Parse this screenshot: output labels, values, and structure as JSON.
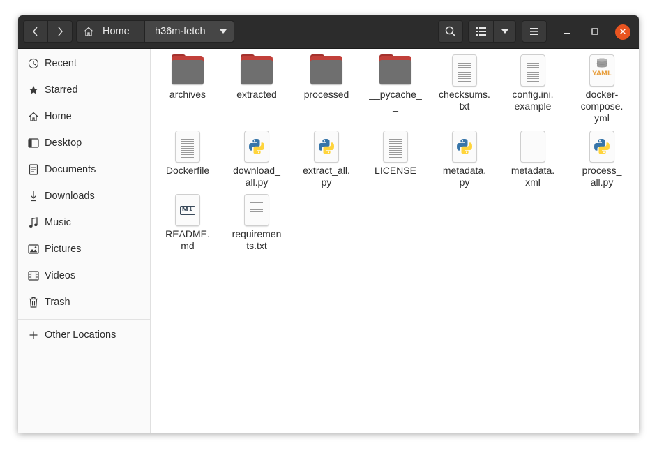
{
  "header": {
    "path_home": "Home",
    "path_current": "h36m-fetch"
  },
  "sidebar": {
    "items": [
      {
        "label": "Recent",
        "icon": "clock-icon"
      },
      {
        "label": "Starred",
        "icon": "star-icon"
      },
      {
        "label": "Home",
        "icon": "home-icon"
      },
      {
        "label": "Desktop",
        "icon": "desktop-icon"
      },
      {
        "label": "Documents",
        "icon": "document-icon"
      },
      {
        "label": "Downloads",
        "icon": "download-icon"
      },
      {
        "label": "Music",
        "icon": "music-note-icon"
      },
      {
        "label": "Pictures",
        "icon": "picture-icon"
      },
      {
        "label": "Videos",
        "icon": "film-icon"
      },
      {
        "label": "Trash",
        "icon": "trash-icon"
      }
    ],
    "other": {
      "label": "Other Locations",
      "icon": "plus-icon"
    }
  },
  "files": [
    {
      "name": "archives",
      "kind": "folder"
    },
    {
      "name": "extracted",
      "kind": "folder"
    },
    {
      "name": "processed",
      "kind": "folder"
    },
    {
      "name": "__pycache__",
      "kind": "folder"
    },
    {
      "name": "checksums.txt",
      "kind": "text"
    },
    {
      "name": "config.ini.example",
      "kind": "text"
    },
    {
      "name": "docker-compose.yml",
      "kind": "yaml"
    },
    {
      "name": "Dockerfile",
      "kind": "text"
    },
    {
      "name": "download_all.py",
      "kind": "python"
    },
    {
      "name": "extract_all.py",
      "kind": "python"
    },
    {
      "name": "LICENSE",
      "kind": "text"
    },
    {
      "name": "metadata.py",
      "kind": "python"
    },
    {
      "name": "metadata.xml",
      "kind": "xml"
    },
    {
      "name": "process_all.py",
      "kind": "python"
    },
    {
      "name": "README.md",
      "kind": "markdown"
    },
    {
      "name": "requirements.txt",
      "kind": "text"
    }
  ],
  "file_label_lines": {
    "3": [
      "__pycache_",
      "_"
    ],
    "4": [
      "checksums.",
      "txt"
    ],
    "5": [
      "config.ini.",
      "example"
    ],
    "6": [
      "docker-",
      "compose.",
      "yml"
    ],
    "8": [
      "download_",
      "all.py"
    ],
    "9": [
      "extract_all.",
      "py"
    ],
    "11": [
      "metadata.",
      "py"
    ],
    "12": [
      "metadata.",
      "xml"
    ],
    "13": [
      "process_",
      "all.py"
    ],
    "14": [
      "README.",
      "md"
    ],
    "15": [
      "requiremen",
      "ts.txt"
    ]
  },
  "icon_badges": {
    "yaml": "YAML",
    "markdown": "M↓",
    "xml": "</>"
  },
  "colors": {
    "accent": "#e95420",
    "folder_front": "#6f6f6f",
    "folder_back": "#c1403a",
    "headerbar": "#2c2c2c"
  }
}
